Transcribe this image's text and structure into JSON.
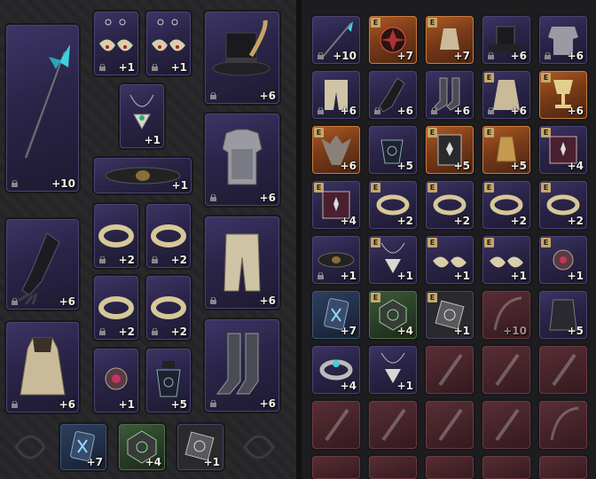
{
  "equipped": {
    "weapon_level": "+10",
    "earring_1_level": "+1",
    "earring_2_level": "+1",
    "hat_level": "+6",
    "necklace_level": "+1",
    "belt_level": "+1",
    "armor_level": "+6",
    "ring_1_level": "+2",
    "ring_2_level": "+2",
    "gloves_level": "+6",
    "pants_level": "+6",
    "ring_3_level": "+2",
    "ring_4_level": "+2",
    "cape_level": "+6",
    "brooch_level": "+1",
    "bottle_level": "+5",
    "boots_level": "+6",
    "rune_1_level": "+7",
    "rune_2_level": "+4",
    "rune_3_level": "+1"
  },
  "inventory": {
    "equip_badge": "E",
    "rows": [
      [
        "+10",
        "+7",
        "+7",
        "+6",
        "+6"
      ],
      [
        "+6",
        "+6",
        "+6",
        "+6",
        "+6"
      ],
      [
        "+6",
        "+5",
        "+5",
        "+5",
        "+4"
      ],
      [
        "+4",
        "+2",
        "+2",
        "+2",
        "+2"
      ],
      [
        "+1",
        "+1",
        "+1",
        "+1",
        "+1"
      ],
      [
        "+7",
        "+4",
        "+1",
        "+10",
        "+5"
      ],
      [
        "+4",
        "+1",
        "",
        "",
        ""
      ]
    ]
  }
}
